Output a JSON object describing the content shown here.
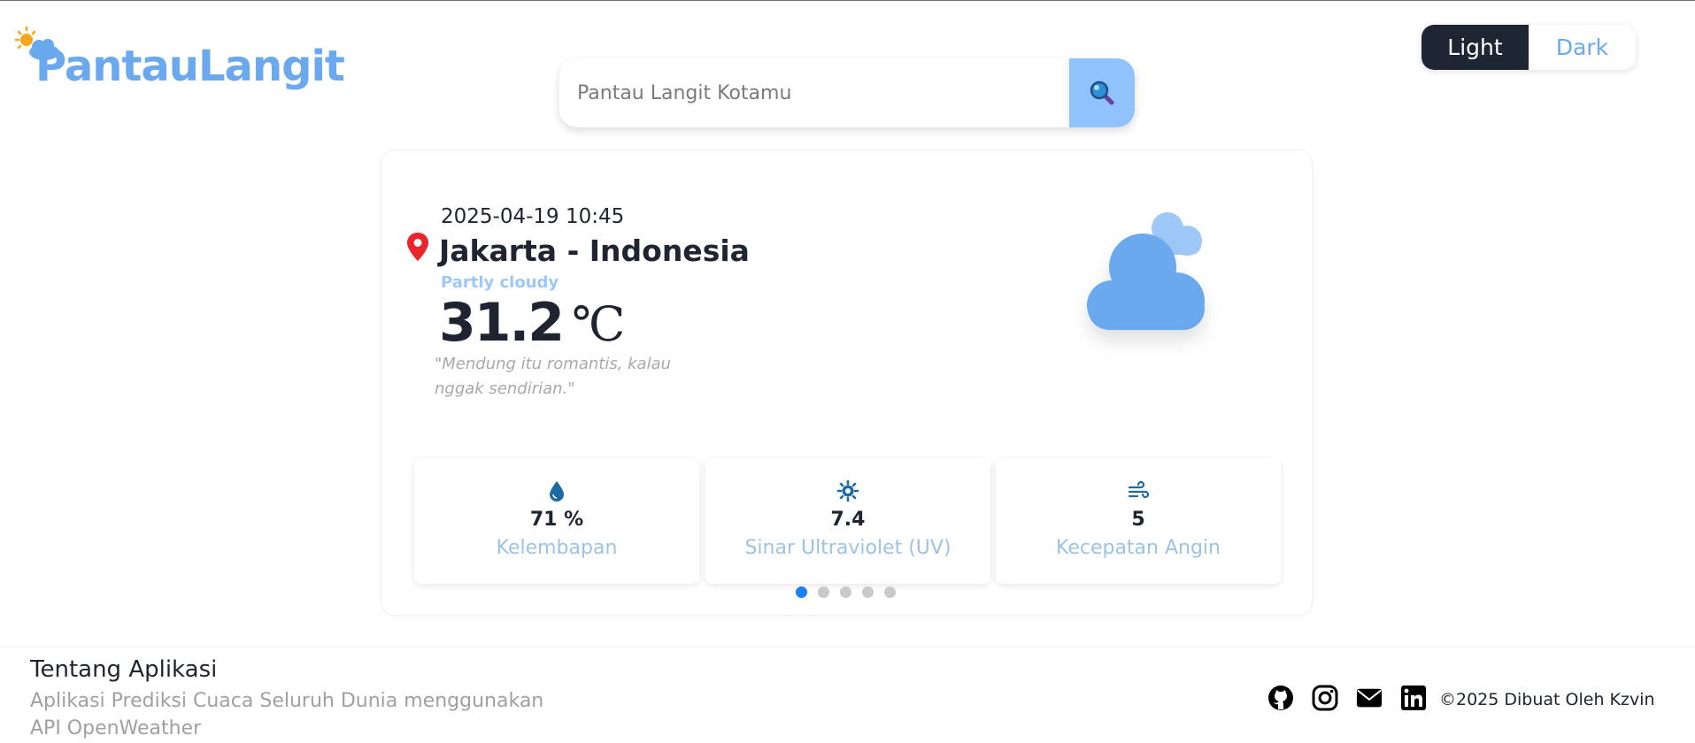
{
  "header": {
    "logo_text": "PantauLangit",
    "logo_icon": "sun-cloud-icon",
    "search": {
      "placeholder": "Pantau Langit Kotamu",
      "button_icon": "search-icon"
    },
    "theme": {
      "light_label": "Light",
      "dark_label": "Dark",
      "selected": "Light"
    }
  },
  "weather": {
    "datetime": "2025-04-19 10:45",
    "location": "Jakarta - Indonesia",
    "condition": "Partly cloudy",
    "temperature": "31.2",
    "unit": "℃",
    "quote": "\"Mendung itu romantis, kalau nggak sendirian.\"",
    "icon": "cloud-icon"
  },
  "stats": [
    {
      "icon": "droplet-icon",
      "value": "71 %",
      "label": "Kelembapan"
    },
    {
      "icon": "sun-gear-icon",
      "value": "7.4",
      "label": "Sinar Ultraviolet (UV)"
    },
    {
      "icon": "wind-icon",
      "value": "5",
      "label": "Kecepatan Angin"
    }
  ],
  "carousel": {
    "total": 5,
    "active": 1
  },
  "footer": {
    "about_title": "Tentang Aplikasi",
    "about_text": "Aplikasi Prediksi Cuaca Seluruh Dunia menggunakan API OpenWeather",
    "socials": [
      "github-icon",
      "instagram-icon",
      "mail-icon",
      "linkedin-icon"
    ],
    "copyright": "©2025 Dibuat Oleh Kzvin"
  },
  "colors": {
    "accent": "#6aa9ee",
    "dark": "#1e2634",
    "pin": "#e8262b",
    "dot_active": "#1a7ef5"
  }
}
